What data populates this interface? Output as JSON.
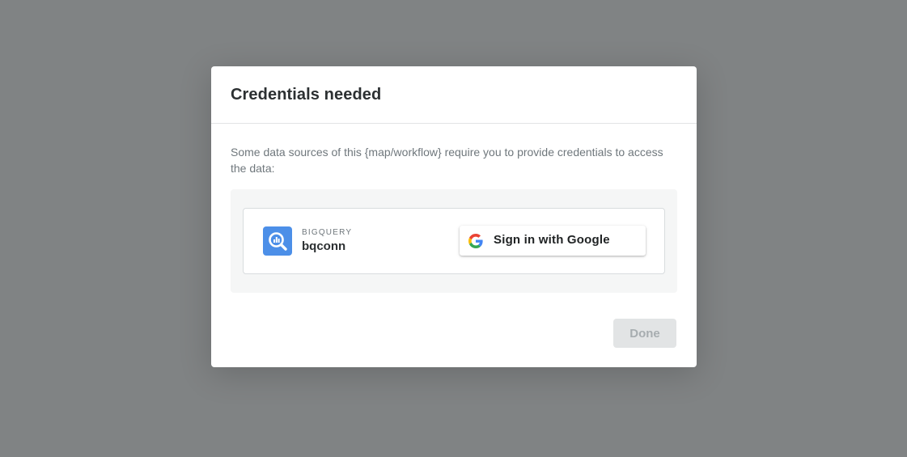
{
  "dialog": {
    "title": "Credentials needed",
    "description": "Some data sources of this {map/workflow} require you to provide credentials to access the data:",
    "done_label": "Done"
  },
  "sources": [
    {
      "type_label": "BIGQUERY",
      "name": "bqconn",
      "icon": "bigquery-icon",
      "sign_in_label": "Sign in with Google",
      "sign_in_icon": "google-icon"
    }
  ],
  "colors": {
    "backdrop": "#808384",
    "bigquery_brand": "#4c8fe8",
    "done_disabled_bg": "#e2e4e5",
    "done_disabled_text": "#a7adb0"
  }
}
